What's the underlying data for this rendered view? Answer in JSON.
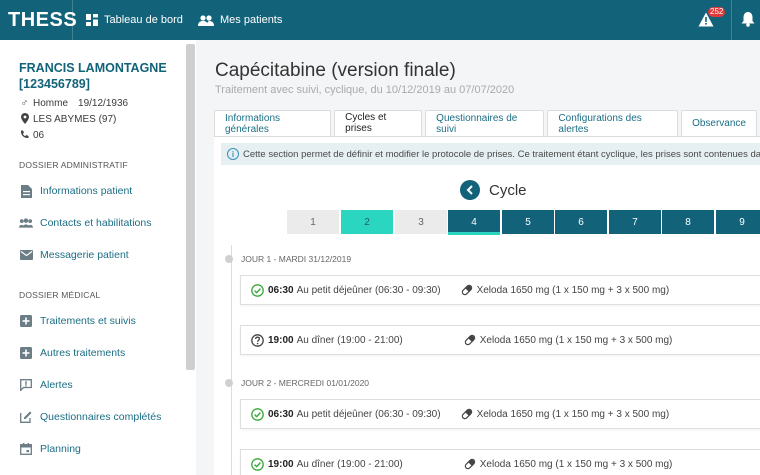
{
  "app": {
    "name": "THESS",
    "nav": [
      {
        "label": "Tableau de bord",
        "icon": "dashboard-icon"
      },
      {
        "label": "Mes patients",
        "icon": "patients-icon"
      }
    ],
    "alert_count": "252",
    "accent_color": "#12637a",
    "highlight_color": "#2ad6c0"
  },
  "patient": {
    "name": "FRANCIS LAMONTAGNE",
    "id": "[123456789]",
    "gender": "Homme",
    "birthdate": "19/12/1936",
    "location": "LES ABYMES (97)",
    "phone": "06"
  },
  "sidebar": {
    "sections": [
      {
        "title": "DOSSIER ADMINISTRATIF",
        "items": [
          {
            "label": "Informations patient",
            "icon": "file-icon"
          },
          {
            "label": "Contacts et habilitations",
            "icon": "group-icon"
          },
          {
            "label": "Messagerie patient",
            "icon": "mail-icon"
          }
        ]
      },
      {
        "title": "DOSSIER MÉDICAL",
        "items": [
          {
            "label": "Traitements et suivis",
            "icon": "plus-square-icon"
          },
          {
            "label": "Autres traitements",
            "icon": "plus-square-icon"
          },
          {
            "label": "Alertes",
            "icon": "alert-bubble-icon"
          },
          {
            "label": "Questionnaires complétés",
            "icon": "edit-icon"
          },
          {
            "label": "Planning",
            "icon": "calendar-icon"
          }
        ]
      }
    ]
  },
  "main": {
    "title": "Capécitabine (version finale)",
    "subtitle": "Traitement avec suivi, cyclique, du 10/12/2019 au 07/07/2020",
    "tabs": [
      {
        "label": "Informations générales",
        "active": false
      },
      {
        "label": "Cycles et prises",
        "active": true
      },
      {
        "label": "Questionnaires de suivi",
        "active": false
      },
      {
        "label": "Configurations des alertes",
        "active": false
      },
      {
        "label": "Observance",
        "active": false
      }
    ],
    "info_text": "Cette section permet de définir et modifier le protocole de prises. Ce traitement étant cyclique, les prises sont contenues dans des cycles.",
    "cycle_label": "Cycle",
    "cycles": [
      {
        "label": "1",
        "state": "past"
      },
      {
        "label": "2",
        "state": "current"
      },
      {
        "label": "3",
        "state": "past"
      },
      {
        "label": "4",
        "state": "selected"
      },
      {
        "label": "5",
        "state": "future"
      },
      {
        "label": "6",
        "state": "future"
      },
      {
        "label": "7",
        "state": "future"
      },
      {
        "label": "8",
        "state": "future"
      },
      {
        "label": "9",
        "state": "future"
      }
    ],
    "days": [
      {
        "label": "JOUR 1 - MARDI 31/12/2019",
        "intakes": [
          {
            "time": "06:30",
            "desc": "Au petit déjeûner (06:30 - 09:30)",
            "drug": "Xeloda 1650 mg (1 x 150 mg + 3 x 500 mg)",
            "status": "done"
          },
          {
            "time": "19:00",
            "desc": "Au dîner (19:00 - 21:00)",
            "drug": "Xeloda 1650 mg (1 x 150 mg + 3 x 500 mg)",
            "status": "unknown"
          }
        ]
      },
      {
        "label": "JOUR 2 - MERCREDI 01/01/2020",
        "intakes": [
          {
            "time": "06:30",
            "desc": "Au petit déjeûner (06:30 - 09:30)",
            "drug": "Xeloda 1650 mg (1 x 150 mg + 3 x 500 mg)",
            "status": "done"
          },
          {
            "time": "19:00",
            "desc": "Au dîner (19:00 - 21:00)",
            "drug": "Xeloda 1650 mg (1 x 150 mg + 3 x 500 mg)",
            "status": "done"
          }
        ]
      }
    ]
  }
}
